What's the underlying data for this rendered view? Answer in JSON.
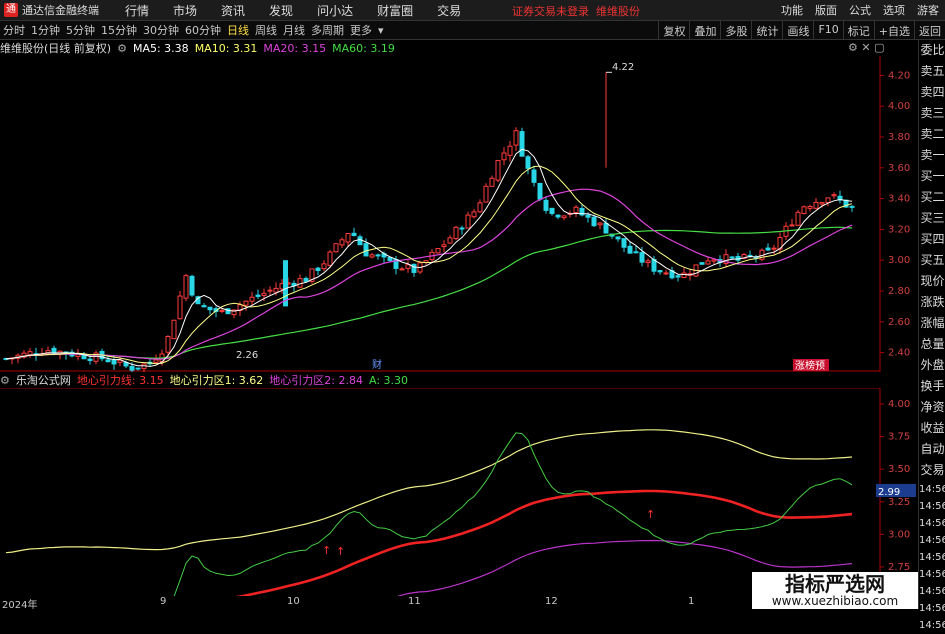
{
  "titlebar": {
    "app": "通达信金融终端",
    "menu": [
      "行情",
      "市场",
      "资讯",
      "发现",
      "问小达",
      "财富圈",
      "交易"
    ],
    "notice": "证券交易未登录",
    "stock": "维维股份",
    "right": [
      "功能",
      "版面",
      "公式",
      "选项",
      "游客"
    ]
  },
  "periods": [
    "分时",
    "1分钟",
    "5分钟",
    "15分钟",
    "30分钟",
    "60分钟",
    "日线",
    "周线",
    "月线",
    "多周期",
    "更多"
  ],
  "active_period": "日线",
  "tools": [
    "复权",
    "叠加",
    "多股",
    "统计",
    "画线",
    "F10",
    "标记",
    "+自选",
    "返回"
  ],
  "main": {
    "title": "维维股份(日线 前复权)",
    "ma": [
      {
        "label": "MA5: 3.38",
        "color": "#ffffff"
      },
      {
        "label": "MA10: 3.31",
        "color": "#ffff66"
      },
      {
        "label": "MA20: 3.15",
        "color": "#dd44dd"
      },
      {
        "label": "MA60: 3.19",
        "color": "#44dd44"
      }
    ],
    "high_mark": "4.22",
    "low_mark": "2.26",
    "fin_mark": "财",
    "badge": "涨榜预"
  },
  "yaxis_main": [
    "4.20",
    "4.00",
    "3.80",
    "3.60",
    "3.40",
    "3.20",
    "3.00",
    "2.80",
    "2.60",
    "2.40"
  ],
  "yaxis_sub": [
    "4.00",
    "3.75",
    "3.50",
    "3.25",
    "3.00",
    "2.75"
  ],
  "sub": {
    "source": "乐淘公式网",
    "lines": [
      {
        "label": "地心引力线: 3.15",
        "color": "#ff3333"
      },
      {
        "label": "地心引力区1: 3.62",
        "color": "#ffff88"
      },
      {
        "label": "地心引力区2: 2.84",
        "color": "#dd44dd"
      },
      {
        "label": "A: 3.30",
        "color": "#44dd44"
      }
    ],
    "cursor_value": "2.99"
  },
  "sidebar": [
    "委比",
    "卖五",
    "卖四",
    "卖三",
    "卖二",
    "卖一",
    "买一",
    "买二",
    "买三",
    "买四",
    "买五",
    "现价",
    "涨跌",
    "涨幅",
    "总量",
    "外盘",
    "换手",
    "净资",
    "收益",
    "自动",
    "交易"
  ],
  "times": [
    "14:56",
    "14:56",
    "14:56",
    "14:56",
    "14:56",
    "14:56",
    "14:56",
    "14:56",
    "14:56"
  ],
  "dates": [
    "2024年",
    "9",
    "10",
    "11",
    "12",
    "1"
  ],
  "watermark": {
    "line1": "指标严选网",
    "line2": "www.xuezhibiao.com"
  },
  "chart_data": {
    "type": "candlestick",
    "ma5": 3.38,
    "ma10": 3.31,
    "ma20": 3.15,
    "ma60": 3.19,
    "high": 4.22,
    "low": 2.26,
    "ylim": [
      2.3,
      4.3
    ]
  }
}
